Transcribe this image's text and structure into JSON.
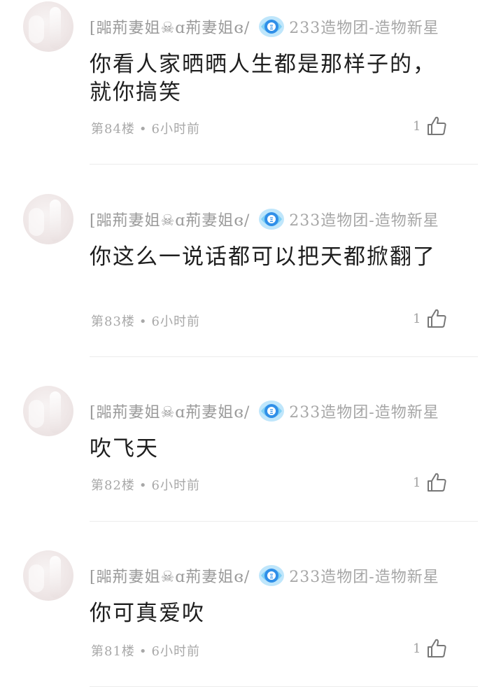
{
  "comments": [
    {
      "username": "[嘂荊妻姐☠ɑ荊妻姐ɞ/",
      "group": "233造物团-造物新星",
      "content": "你看人家晒晒人生都是那样子的，就你搞笑",
      "floor": "第84楼",
      "time": "6小时前",
      "likes": "1"
    },
    {
      "username": "[嘂荊妻姐☠ɑ荊妻姐ɞ/",
      "group": "233造物团-造物新星",
      "content": "你这么一说话都可以把天都掀翻了",
      "floor": "第83楼",
      "time": "6小时前",
      "likes": "1"
    },
    {
      "username": "[嘂荊妻姐☠ɑ荊妻姐ɞ/",
      "group": "233造物团-造物新星",
      "content": "吹飞天",
      "floor": "第82楼",
      "time": "6小时前",
      "likes": "1"
    },
    {
      "username": "[嘂荊妻姐☠ɑ荊妻姐ɞ/",
      "group": "233造物团-造物新星",
      "content": "你可真爱吹",
      "floor": "第81楼",
      "time": "6小时前",
      "likes": "1"
    }
  ],
  "icons": {
    "badge": "creator-badge-icon",
    "like": "thumbs-up-icon"
  },
  "colors": {
    "badge_primary": "#2f8fe8",
    "badge_light": "#7fd0f5",
    "meta_text": "#a8a8a8"
  }
}
